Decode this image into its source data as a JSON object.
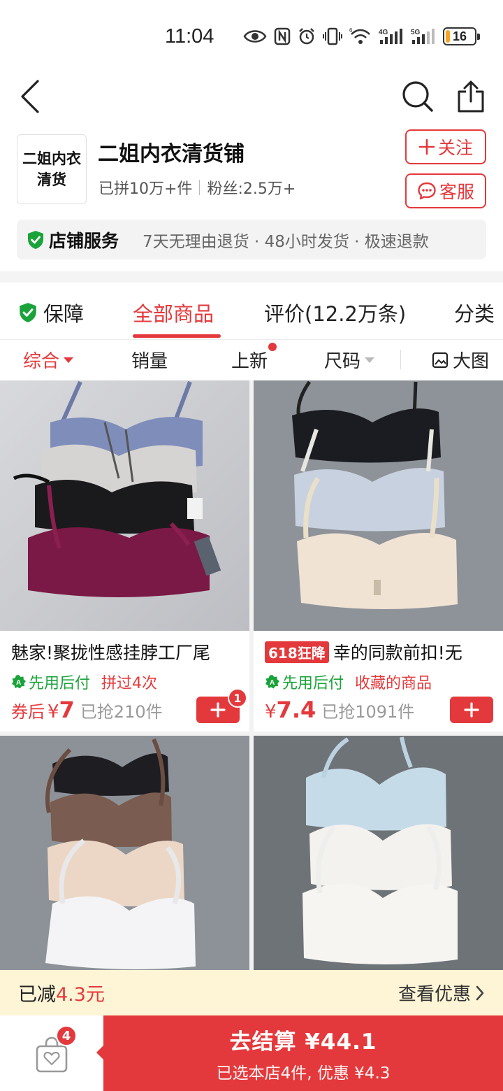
{
  "status_bar": {
    "time": "11:04",
    "battery": "16",
    "battery_level": 0.16
  },
  "shop": {
    "logo_text": "二姐内衣清货",
    "name": "二姐内衣清货铺",
    "sold": "已拼10万+件",
    "fans": "粉丝:2.5万+",
    "follow_label": "关注",
    "service_label": "客服"
  },
  "service": {
    "title": "店铺服务",
    "desc": "7天无理由退货 · 48小时发货 · 极速退款"
  },
  "tabs": {
    "guarantee": "保障",
    "all": "全部商品",
    "reviews": "评价(12.2万条)",
    "category": "分类"
  },
  "sort": {
    "default": "综合",
    "sales": "销量",
    "new": "上新",
    "size": "尺码",
    "bigview": "大图"
  },
  "products": [
    {
      "title": "魅家!聚拢性感挂脖工厂尾",
      "tag": "",
      "pay": "先用后付",
      "promo": "拼过4次",
      "price_prefix": "券后",
      "currency": "¥",
      "price": "7",
      "sold": "已抢210件",
      "cart_count": "1"
    },
    {
      "title": "幸的同款前扣!无",
      "tag": "618狂降",
      "pay": "先用后付",
      "promo": "收藏的商品",
      "price_prefix": "",
      "currency": "¥",
      "price": "7.4",
      "sold": "已抢1091件",
      "cart_count": ""
    }
  ],
  "discount": {
    "prefix": "已减",
    "amount": "4.3元",
    "link": "查看优惠"
  },
  "bottom": {
    "cart_count": "4",
    "checkout_main": "去结算 ¥44.1",
    "checkout_sub": "已选本店4件, 优惠 ¥4.3"
  },
  "colors": {
    "accent": "#e4393c",
    "green": "#1aa33a",
    "discount_bg": "#fdf5d6"
  }
}
